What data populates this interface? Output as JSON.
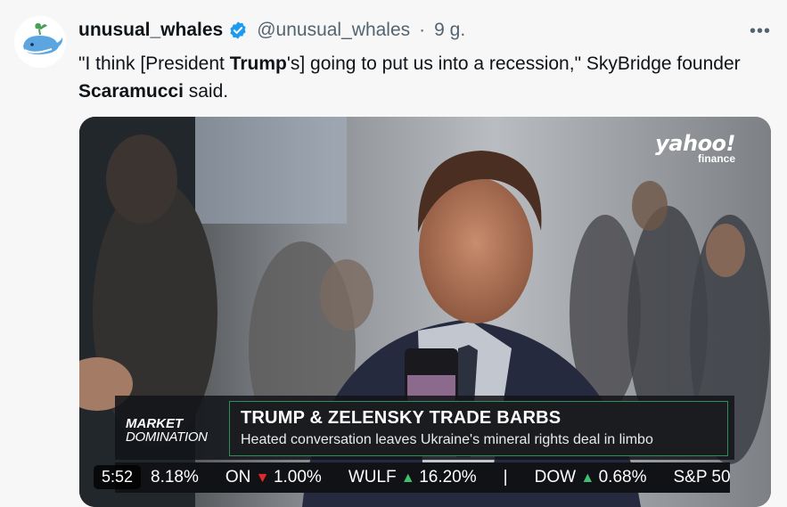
{
  "tweet": {
    "author_name": "unusual_whales",
    "handle": "@unusual_whales",
    "separator": "·",
    "time": "9 g.",
    "more_label": "•••",
    "text_parts": {
      "p1": "\"I think [President ",
      "b1": "Trump",
      "p2": "'s] going to put us into a recession,\" SkyBridge founder ",
      "b2": "Scaramucci",
      "p3": " said."
    }
  },
  "video": {
    "logo_main": "yahoo!",
    "logo_sub": "finance",
    "market_line1": "MARKET",
    "market_line2": "DOMINATION",
    "headline": "TRUMP & ZELENSKY TRADE BARBS",
    "subheadline": "Heated conversation leaves Ukraine's mineral rights deal in limbo",
    "duration": "5:52",
    "ticker": [
      {
        "label": "",
        "dir": "",
        "value": "8.18%"
      },
      {
        "label": "ON",
        "dir": "down",
        "value": "1.00%"
      },
      {
        "label": "WULF",
        "dir": "up",
        "value": "16.20%"
      },
      {
        "label": "|",
        "dir": "",
        "value": ""
      },
      {
        "label": "DOW",
        "dir": "up",
        "value": "0.68%"
      },
      {
        "label": "S&P 50",
        "dir": "",
        "value": ""
      }
    ]
  }
}
